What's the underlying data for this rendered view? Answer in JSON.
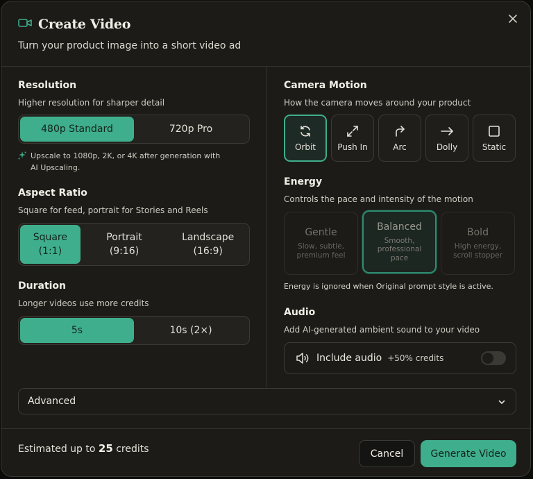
{
  "header": {
    "title": "Create Video",
    "subtitle": "Turn your product image into a short video ad"
  },
  "resolution": {
    "title": "Resolution",
    "desc": "Higher resolution for sharper detail",
    "options": [
      "480p Standard",
      "720p Pro"
    ],
    "selected": "480p Standard",
    "note": "Upscale to 1080p, 2K, or 4K after generation with AI Upscaling."
  },
  "aspect": {
    "title": "Aspect Ratio",
    "desc": "Square for feed, portrait for Stories and Reels",
    "options": [
      "Square (1:1)",
      "Portrait (9:16)",
      "Landscape (16:9)"
    ],
    "selected": "Square (1:1)"
  },
  "duration": {
    "title": "Duration",
    "desc": "Longer videos use more credits",
    "options": [
      "5s",
      "10s (2×)"
    ],
    "selected": "5s"
  },
  "camera": {
    "title": "Camera Motion",
    "desc": "How the camera moves around your product",
    "options": [
      {
        "label": "Orbit",
        "icon": "refresh-icon"
      },
      {
        "label": "Push In",
        "icon": "expand-icon"
      },
      {
        "label": "Arc",
        "icon": "arc-arrow-icon"
      },
      {
        "label": "Dolly",
        "icon": "arrow-right-icon"
      },
      {
        "label": "Static",
        "icon": "square-icon"
      }
    ],
    "selected": "Orbit"
  },
  "energy": {
    "title": "Energy",
    "desc": "Controls the pace and intensity of the motion",
    "options": [
      {
        "name": "Gentle",
        "desc": "Slow, subtle, premium feel"
      },
      {
        "name": "Balanced",
        "desc": "Smooth, professional pace"
      },
      {
        "name": "Bold",
        "desc": "High energy, scroll stopper"
      }
    ],
    "selected": "Balanced",
    "note": "Energy is ignored when Original prompt style is active."
  },
  "audio": {
    "title": "Audio",
    "desc": "Add AI-generated ambient sound to your video",
    "label": "Include audio",
    "credits": "+50% credits",
    "enabled": false
  },
  "advanced": {
    "label": "Advanced"
  },
  "footer": {
    "estimate_prefix": "Estimated up to",
    "estimate_value": "25",
    "estimate_suffix": "credits",
    "cancel": "Cancel",
    "generate": "Generate Video"
  },
  "colors": {
    "accent": "#3fae8c",
    "background": "#1c1b18",
    "border": "#3b3a34"
  }
}
